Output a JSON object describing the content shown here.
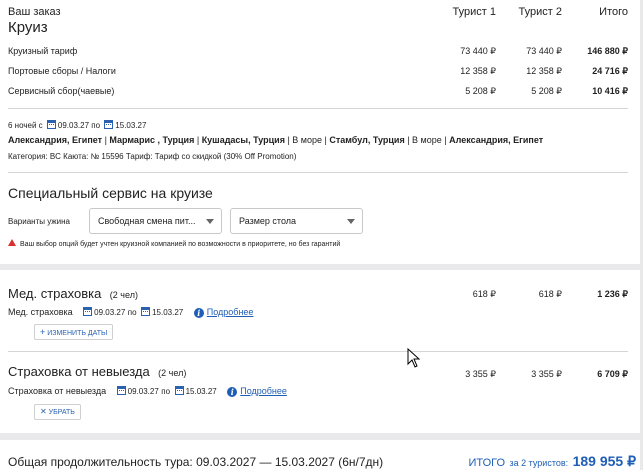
{
  "order": {
    "title": "Ваш заказ",
    "subtitle": "Круиз",
    "columns": [
      "Турист 1",
      "Турист 2",
      "Итого"
    ],
    "rows": [
      {
        "label": "Круизный тариф",
        "t1": "73 440 ₽",
        "t2": "73 440 ₽",
        "total": "146 880 ₽"
      },
      {
        "label": "Портовые сборы / Налоги",
        "t1": "12 358 ₽",
        "t2": "12 358 ₽",
        "total": "24 716 ₽"
      },
      {
        "label": "Сервисный сбор(чаевые)",
        "t1": "5 208 ₽",
        "t2": "5 208 ₽",
        "total": "10 416 ₽"
      }
    ]
  },
  "cruise": {
    "nights": "6 ночей с",
    "date_from": "09.03.27",
    "by": "по",
    "date_to": "15.03.27",
    "route": [
      {
        "text": "Александрия, Египет",
        "bold": true
      },
      {
        "text": " | ",
        "bold": false
      },
      {
        "text": "Мармарис , Турция",
        "bold": true
      },
      {
        "text": " | ",
        "bold": false
      },
      {
        "text": "Кушадасы, Турция",
        "bold": true
      },
      {
        "text": " | В море | ",
        "bold": false
      },
      {
        "text": "Стамбул, Турция",
        "bold": true
      },
      {
        "text": " | В море | ",
        "bold": false
      },
      {
        "text": "Александрия, Египет",
        "bold": true
      }
    ],
    "details": "Категория: BC  Каюта: № 15596  Тариф: Тариф со скидкой (30% Off Promotion)"
  },
  "special_service": {
    "title": "Специальный сервис на круизе",
    "dinner_label": "Варианты ужина",
    "dinner_value": "Свободная смена пит...",
    "table_value": "Размер стола",
    "warning": "Ваш выбор опций будет учтен круизной компанией по возможности в приоритете, но без гарантий"
  },
  "insurance_med": {
    "title": "Мед. страховка",
    "persons": "(2 чел)",
    "t1": "618 ₽",
    "t2": "618 ₽",
    "total": "1 236 ₽",
    "item_label": "Мед. страховка",
    "date_from": "09.03.27",
    "by": "по",
    "date_to": "15.03.27",
    "more_link": "Подробнее",
    "button": "ИЗМЕНИТЬ ДАТЫ"
  },
  "insurance_cancel": {
    "title": "Страховка от невыезда",
    "persons": "(2 чел)",
    "t1": "3 355 ₽",
    "t2": "3 355 ₽",
    "total": "6 709 ₽",
    "item_label": "Страховка от невыезда",
    "date_from": "09.03.27",
    "by": "по",
    "date_to": "15.03.27",
    "more_link": "Подробнее",
    "button": "УБРАТЬ"
  },
  "summary": {
    "duration": "Общая продолжительность тура: 09.03.2027 — 15.03.2027 (6н/7дн)",
    "total_label": "ИТОГО",
    "for_tourists": "за 2 туристов:",
    "total_value": "189 955 ₽"
  },
  "colors": {
    "accent": "#1f5eb6",
    "warning": "#d9302e",
    "background": "#e9e9ec"
  }
}
